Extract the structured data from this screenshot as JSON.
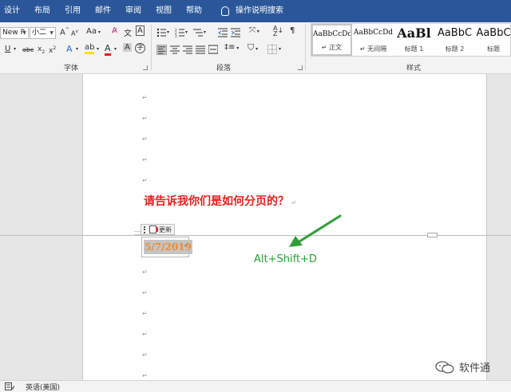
{
  "menu": {
    "tabs": [
      "设计",
      "布局",
      "引用",
      "邮件",
      "审阅",
      "视图",
      "帮助"
    ],
    "search_label": "操作说明搜索"
  },
  "font_group": {
    "font_name": "New R",
    "font_size": "小二",
    "label": "字体"
  },
  "paragraph_group": {
    "label": "段落"
  },
  "styles_group": {
    "label": "样式",
    "items": [
      {
        "sample": "AaBbCcDd",
        "name": "↵ 正文"
      },
      {
        "sample": "AaBbCcDd",
        "name": "↵ 无间隔"
      },
      {
        "sample": "AaBl",
        "name": "标题 1"
      },
      {
        "sample": "AaBbC",
        "name": "标题 2"
      },
      {
        "sample": "AaBbC",
        "name": "标题"
      }
    ]
  },
  "document": {
    "question": "请告诉我你们是如何分页的？",
    "field_update_label": "更新",
    "date_value": "5/7/2019",
    "shortcut_text": "Alt+Shift+D",
    "watermark_text": "软件通",
    "paragraph_mark": "↵"
  },
  "status": {
    "language": "英语(美国)"
  },
  "colors": {
    "title_bar": "#2b579a",
    "question_red": "#e8201c",
    "date_orange": "#f28a2a",
    "shortcut_green": "#25a23a",
    "arrow_green": "#2e9e3a"
  }
}
